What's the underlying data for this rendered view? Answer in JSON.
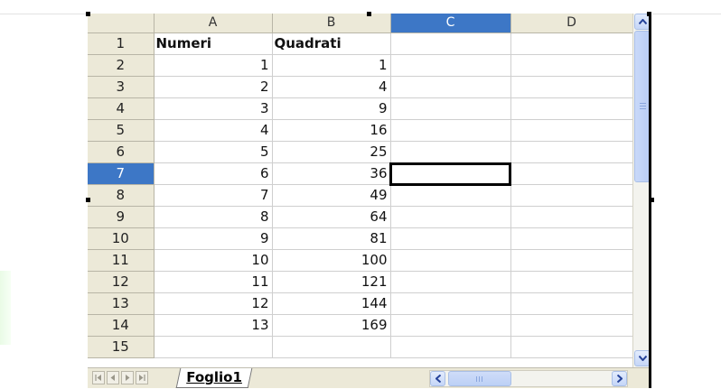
{
  "sheet": {
    "columns": [
      "A",
      "B",
      "C",
      "D"
    ],
    "selected_column": "C",
    "selected_row": "7",
    "rows": [
      {
        "n": "1",
        "a": "Numeri",
        "b": "Quadrati"
      },
      {
        "n": "2",
        "a": "1",
        "b": "1"
      },
      {
        "n": "3",
        "a": "2",
        "b": "4"
      },
      {
        "n": "4",
        "a": "3",
        "b": "9"
      },
      {
        "n": "5",
        "a": "4",
        "b": "16"
      },
      {
        "n": "6",
        "a": "5",
        "b": "25"
      },
      {
        "n": "7",
        "a": "6",
        "b": "36"
      },
      {
        "n": "8",
        "a": "7",
        "b": "49"
      },
      {
        "n": "9",
        "a": "8",
        "b": "64"
      },
      {
        "n": "10",
        "a": "9",
        "b": "81"
      },
      {
        "n": "11",
        "a": "10",
        "b": "100"
      },
      {
        "n": "12",
        "a": "11",
        "b": "121"
      },
      {
        "n": "13",
        "a": "12",
        "b": "144"
      },
      {
        "n": "14",
        "a": "13",
        "b": "169"
      },
      {
        "n": "15",
        "a": "",
        "b": ""
      }
    ]
  },
  "tabs": {
    "sheet1": "Foglio1"
  },
  "icons": {
    "nav": [
      "first-sheet-icon",
      "prev-sheet-icon",
      "next-sheet-icon",
      "last-sheet-icon"
    ],
    "scroll": [
      "scroll-up-icon",
      "scroll-down-icon",
      "scroll-left-icon",
      "scroll-right-icon"
    ]
  },
  "colors": {
    "selection": "#3d77c6",
    "header": "#ece9d8",
    "scrollbar": "#c5d6f7"
  }
}
